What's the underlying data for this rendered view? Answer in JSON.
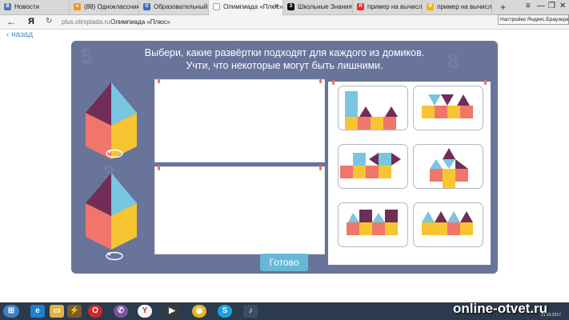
{
  "browser": {
    "tabs": [
      {
        "label": "Новости",
        "icon": "vk-icon",
        "color": "#4a76a8",
        "glyph": "В"
      },
      {
        "label": "(88) Одноклассники",
        "icon": "ok-icon",
        "color": "#f7931e",
        "glyph": "о"
      },
      {
        "label": "Образовательный пор",
        "icon": "school-icon",
        "color": "#3c64c8",
        "glyph": "О"
      },
      {
        "label": "Олимпиада «Плюс»",
        "icon": "page-icon",
        "color": "#9aa3ad",
        "glyph": ""
      },
      {
        "label": "Школьные Знания.com",
        "icon": "znania-icon",
        "color": "#111111",
        "glyph": "З"
      },
      {
        "label": "пример на вычислени",
        "icon": "yandex-icon",
        "color": "#e0322a",
        "glyph": "Я"
      },
      {
        "label": "пример на вычислени",
        "icon": "yandex-disk-icon",
        "color": "#f2b31a",
        "glyph": "Я"
      }
    ],
    "tooltip": "Настройки Яндекс.Браузера",
    "url_domain": "plus.olimpiada.ru",
    "url_title": "Олимпиада «Плюс»",
    "back_glyph": "←",
    "yandex_glyph": "Я",
    "reload_glyph": "↻",
    "new_tab_glyph": "+",
    "window_controls": [
      "≡",
      "—",
      "❐",
      "✕"
    ]
  },
  "page": {
    "back_link": "назад",
    "instruction_line1": "Выбери, какие развёртки подходят для каждого из домиков.",
    "instruction_line2": "Учти, что некоторые могут быть лишними.",
    "ready_button": "Готово",
    "rotate_glyph": "↻"
  },
  "colors": {
    "board_bg": "#68749a",
    "red": "#f0766a",
    "yellow": "#f7c531",
    "blue": "#79c6e3",
    "purple": "#6f2d57",
    "accent_button": "#67b7d8"
  },
  "taskbar": {
    "items": [
      "start-button",
      "ie-icon",
      "explorer-icon",
      "winamp-icon",
      "opera-icon",
      "viber-icon",
      "yandex-browser-icon",
      "video-icon",
      "chrome-icon",
      "skype-icon",
      "audio-icon"
    ],
    "watermark": "online-otvet.ru",
    "clock": "21.03.2017"
  }
}
